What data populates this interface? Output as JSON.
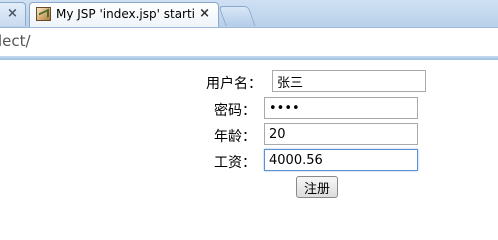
{
  "browser": {
    "tabs": [
      {
        "title": "",
        "close": "×"
      },
      {
        "title": "My JSP 'index.jsp' starti",
        "close": "×",
        "active": true
      }
    ],
    "address": "lect/"
  },
  "form": {
    "username": {
      "label": "用户名：",
      "value": "张三"
    },
    "password": {
      "label": "密码：",
      "value": "1234"
    },
    "age": {
      "label": "年龄：",
      "value": "20"
    },
    "salary": {
      "label": "工资：",
      "value": "4000.56"
    },
    "submit_label": "注册"
  }
}
